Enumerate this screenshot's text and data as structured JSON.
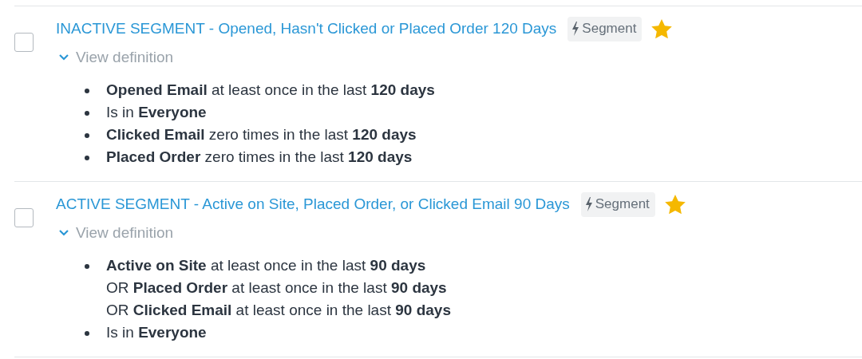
{
  "segments": [
    {
      "checked": false,
      "title": "INACTIVE SEGMENT - Opened, Hasn't Clicked or Placed Order 120 Days",
      "badge": "Segment",
      "starred": true,
      "toggle": "View definition",
      "expanded": true,
      "definition": [
        {
          "lines": [
            "**Opened Email** at least once in the last **120 days**"
          ]
        },
        {
          "lines": [
            "Is in **Everyone**"
          ]
        },
        {
          "lines": [
            "**Clicked Email** zero times in the last **120 days**"
          ]
        },
        {
          "lines": [
            "**Placed Order** zero times in the last **120 days**"
          ]
        }
      ]
    },
    {
      "checked": false,
      "title": "ACTIVE SEGMENT - Active on Site, Placed Order, or Clicked Email 90 Days",
      "badge": "Segment",
      "starred": true,
      "toggle": "View definition",
      "expanded": true,
      "definition": [
        {
          "lines": [
            "**Active on Site** at least once in the last **90 days**",
            "OR **Placed Order** at least once in the last **90 days**",
            "OR **Clicked Email** at least once in the last **90 days**"
          ]
        },
        {
          "lines": [
            "Is in **Everyone**"
          ]
        }
      ]
    }
  ]
}
